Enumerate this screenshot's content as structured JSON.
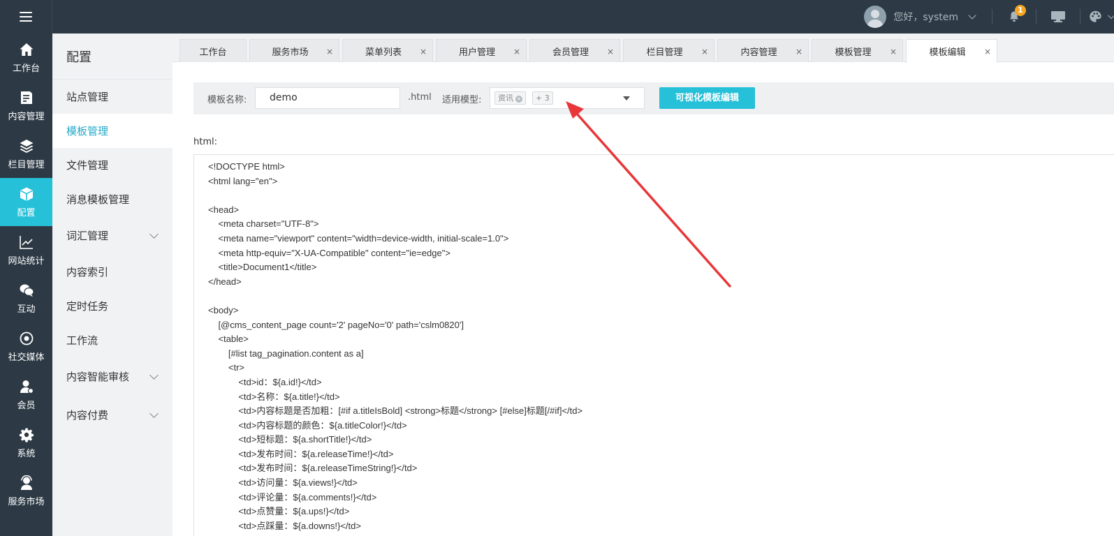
{
  "header": {
    "user_greeting": "您好，system",
    "notification_count": "1"
  },
  "left_nav": [
    {
      "label": "工作台",
      "icon": "home-icon"
    },
    {
      "label": "内容管理",
      "icon": "document-edit-icon"
    },
    {
      "label": "栏目管理",
      "icon": "layers-icon"
    },
    {
      "label": "配置",
      "icon": "cube-icon",
      "active": true
    },
    {
      "label": "网站统计",
      "icon": "line-chart-icon"
    },
    {
      "label": "互动",
      "icon": "chat-bubbles-icon"
    },
    {
      "label": "社交媒体",
      "icon": "target-icon"
    },
    {
      "label": "会员",
      "icon": "member-icon"
    },
    {
      "label": "系统",
      "icon": "gear-icon"
    },
    {
      "label": "服务市场",
      "icon": "support-agent-icon"
    }
  ],
  "sidebar": {
    "title": "配置",
    "items": [
      {
        "label": "站点管理"
      },
      {
        "label": "模板管理",
        "active": true
      },
      {
        "label": "文件管理"
      },
      {
        "label": "消息模板管理"
      },
      {
        "label": "词汇管理",
        "expandable": true
      },
      {
        "label": "内容索引"
      },
      {
        "label": "定时任务"
      },
      {
        "label": "工作流"
      },
      {
        "label": "内容智能审核",
        "expandable": true
      },
      {
        "label": "内容付费",
        "expandable": true
      }
    ]
  },
  "tabs": [
    {
      "label": "工作台",
      "close": ""
    },
    {
      "label": "服务市场",
      "close": "×"
    },
    {
      "label": "菜单列表",
      "close": "×"
    },
    {
      "label": "用户管理",
      "close": "×"
    },
    {
      "label": "会员管理",
      "close": "×"
    },
    {
      "label": "栏目管理",
      "close": "×"
    },
    {
      "label": "内容管理",
      "close": "×"
    },
    {
      "label": "模板管理",
      "close": "×"
    },
    {
      "label": "模板编辑",
      "close": "×",
      "active": true
    }
  ],
  "form": {
    "name_label": "模板名称:",
    "name_value": "demo",
    "suffix": ".html",
    "model_label": "适用模型:",
    "model_chip": "资讯",
    "model_chip_remove": "×",
    "model_more": "+ 3",
    "visual_edit_button": "可视化模板编辑"
  },
  "editor": {
    "label": "html:",
    "lines": [
      "<!DOCTYPE html>",
      "<html lang=\"en\">",
      "",
      "<head>",
      "    <meta charset=\"UTF-8\">",
      "    <meta name=\"viewport\" content=\"width=device-width, initial-scale=1.0\">",
      "    <meta http-equiv=\"X-UA-Compatible\" content=\"ie=edge\">",
      "    <title>Document1</title>",
      "</head>",
      "",
      "<body>",
      "    [@cms_content_page count='2' pageNo='0' path='cslm0820']",
      "    <table>",
      "        [#list tag_pagination.content as a]",
      "        <tr>",
      "            <td>id：${a.id!}</td>",
      "            <td>名称：${a.title!}</td>",
      "            <td>内容标题是否加粗：[#if a.titleIsBold] <strong>标题</strong> [#else]标题[/#if]</td>",
      "            <td>内容标题的颜色：${a.titleColor!}</td>",
      "            <td>短标题：${a.shortTitle!}</td>",
      "            <td>发布时间：${a.releaseTime!}</td>",
      "            <td>发布时间：${a.releaseTimeString!}</td>",
      "            <td>访问量：${a.views!}</td>",
      "            <td>评论量：${a.comments!}</td>",
      "            <td>点赞量：${a.ups!}</td>",
      "            <td>点踩量：${a.downs!}</td>"
    ]
  },
  "colors": {
    "accent": "#26c0d8",
    "dark_nav": "#2d3a45",
    "annotation_arrow": "#e8363a"
  }
}
